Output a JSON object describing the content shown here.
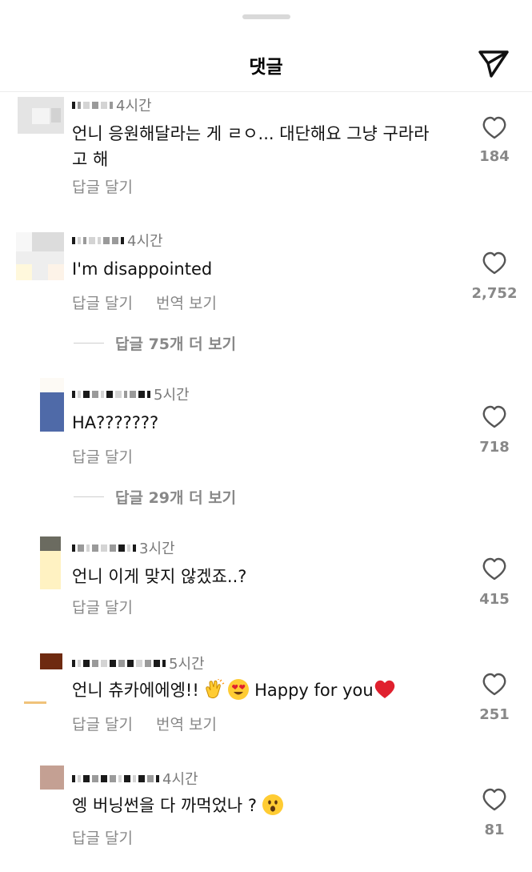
{
  "header": {
    "title": "댓글"
  },
  "comments": [
    {
      "time": "4시간",
      "text": "언니 응원해달라는 게 ㄹㅇ... 대단해요 그냥 구라라\n고 해",
      "reply_label": "답글 달기",
      "like_count": "184"
    },
    {
      "time": "4시간",
      "text": "I'm disappointed",
      "reply_label": "답글 달기",
      "translate_label": "번역 보기",
      "like_count": "2,752",
      "view_replies": "답글 75개 더 보기"
    },
    {
      "time": "5시간",
      "text": "HA???????",
      "reply_label": "답글 달기",
      "like_count": "718",
      "view_replies": "답글 29개 더 보기"
    },
    {
      "time": "3시간",
      "text": "언니 이게 맞지 않겠죠..?",
      "reply_label": "답글 달기",
      "like_count": "415"
    },
    {
      "time": "5시간",
      "text_before": "언니 츄카에에엥!! ",
      "text_after": " Happy for you",
      "reply_label": "답글 달기",
      "translate_label": "번역 보기",
      "like_count": "251"
    },
    {
      "time": "4시간",
      "text_before": "엥 버닝썬을 다 까먹었나 ? ",
      "reply_label": "답글 달기",
      "like_count": "81"
    }
  ],
  "icons": {
    "send": "paper-plane-icon",
    "like": "heart-outline-icon",
    "emoji": [
      "clapping-hands-emoji",
      "heart-eyes-emoji",
      "red-heart-emoji",
      "surprised-face-emoji"
    ]
  },
  "colors": {
    "muted": "#888888",
    "divider": "#ececec",
    "heart_red": "#e0202e",
    "emoji_yellow": "#ffcc33"
  }
}
